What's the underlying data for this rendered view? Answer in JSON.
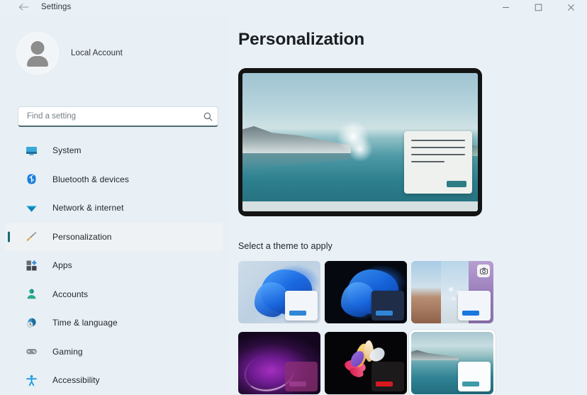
{
  "window": {
    "app_title": "Settings",
    "back_icon": "back-arrow-icon",
    "controls": [
      {
        "name": "minimize",
        "glyph": "–"
      },
      {
        "name": "maximize",
        "glyph": "☐"
      },
      {
        "name": "close",
        "glyph": "✕"
      }
    ]
  },
  "sidebar": {
    "account": {
      "name": "Local Account",
      "avatar_icon": "user-avatar-icon"
    },
    "search": {
      "placeholder": "Find a setting",
      "value": "",
      "icon": "search-icon"
    },
    "items": [
      {
        "label": "System",
        "icon": "monitor-icon",
        "selected": false
      },
      {
        "label": "Bluetooth & devices",
        "icon": "bluetooth-icon",
        "selected": false
      },
      {
        "label": "Network & internet",
        "icon": "wifi-icon",
        "selected": false
      },
      {
        "label": "Personalization",
        "icon": "paintbrush-icon",
        "selected": true
      },
      {
        "label": "Apps",
        "icon": "apps-grid-icon",
        "selected": false
      },
      {
        "label": "Accounts",
        "icon": "person-icon",
        "selected": false
      },
      {
        "label": "Time & language",
        "icon": "clock-globe-icon",
        "selected": false
      },
      {
        "label": "Gaming",
        "icon": "gamepad-icon",
        "selected": false
      },
      {
        "label": "Accessibility",
        "icon": "accessibility-icon",
        "selected": false
      }
    ]
  },
  "main": {
    "title": "Personalization",
    "preview": {
      "name": "desktop-preview",
      "description": "Lake and mountain sunrise wallpaper with sample window"
    },
    "themes_label": "Select a theme to apply",
    "themes": [
      {
        "name": "theme-windows-light",
        "selected": false
      },
      {
        "name": "theme-windows-dark",
        "selected": false
      },
      {
        "name": "theme-slideshow",
        "selected": false,
        "badge_icon": "camera-icon"
      },
      {
        "name": "theme-purple-glow",
        "selected": false
      },
      {
        "name": "theme-flower-dark",
        "selected": false
      },
      {
        "name": "theme-lake",
        "selected": true
      }
    ]
  },
  "colors": {
    "page_background": "#eaf1f6",
    "sidebar_background": "#e9f0f5",
    "accent": "#156b70",
    "selected_nav_background": "#eef2f5",
    "text_primary": "#1b1f23"
  }
}
